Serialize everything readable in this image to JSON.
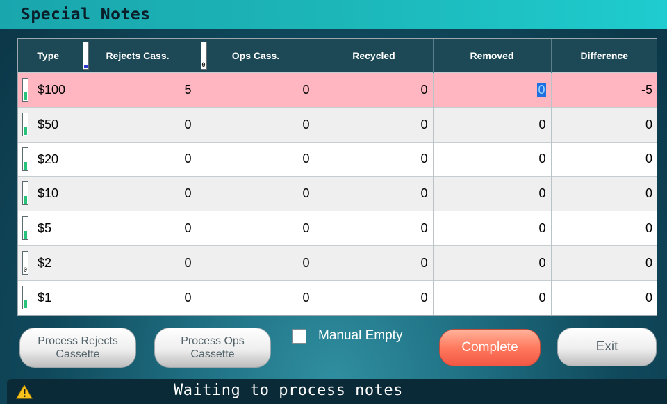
{
  "window": {
    "title": "Special Notes"
  },
  "table": {
    "columns": [
      "Type",
      "Rejects Cass.",
      "Ops Cass.",
      "Recycled",
      "Removed",
      "Difference"
    ],
    "header_gauges": {
      "rejects": {
        "fill_fraction": 0.12,
        "color": "#2d3bd4"
      },
      "ops": {
        "label": "0"
      }
    },
    "rows": [
      {
        "type": "$100",
        "rejects": "5",
        "ops": "0",
        "recycled": "0",
        "removed": "0",
        "difference": "-5",
        "highlight": true,
        "gauge_fill": 0.35
      },
      {
        "type": "$50",
        "rejects": "0",
        "ops": "0",
        "recycled": "0",
        "removed": "0",
        "difference": "0",
        "gauge_fill": 0.35
      },
      {
        "type": "$20",
        "rejects": "0",
        "ops": "0",
        "recycled": "0",
        "removed": "0",
        "difference": "0",
        "gauge_fill": 0.35
      },
      {
        "type": "$10",
        "rejects": "0",
        "ops": "0",
        "recycled": "0",
        "removed": "0",
        "difference": "0",
        "gauge_fill": 0.35
      },
      {
        "type": "$5",
        "rejects": "0",
        "ops": "0",
        "recycled": "0",
        "removed": "0",
        "difference": "0",
        "gauge_fill": 0.35
      },
      {
        "type": "$2",
        "rejects": "0",
        "ops": "0",
        "recycled": "0",
        "removed": "0",
        "difference": "0",
        "gauge_label": "0"
      },
      {
        "type": "$1",
        "rejects": "0",
        "ops": "0",
        "recycled": "0",
        "removed": "0",
        "difference": "0",
        "gauge_fill": 0.35
      }
    ]
  },
  "buttons": {
    "process_rejects": [
      "Process Rejects",
      "Cassette"
    ],
    "process_ops": [
      "Process Ops",
      "Cassette"
    ],
    "complete": "Complete",
    "exit": "Exit"
  },
  "manual_empty": {
    "label": "Manual Empty",
    "checked": false
  },
  "status": {
    "text": "Waiting to process notes",
    "icon": "warning-icon"
  },
  "colors": {
    "header_bg": "#1d4957",
    "highlight_row": "#ffb6c1",
    "complete_button": "#ff7a5e",
    "gauge_green": "#27c37a",
    "gauge_blue": "#2d3bd4"
  }
}
